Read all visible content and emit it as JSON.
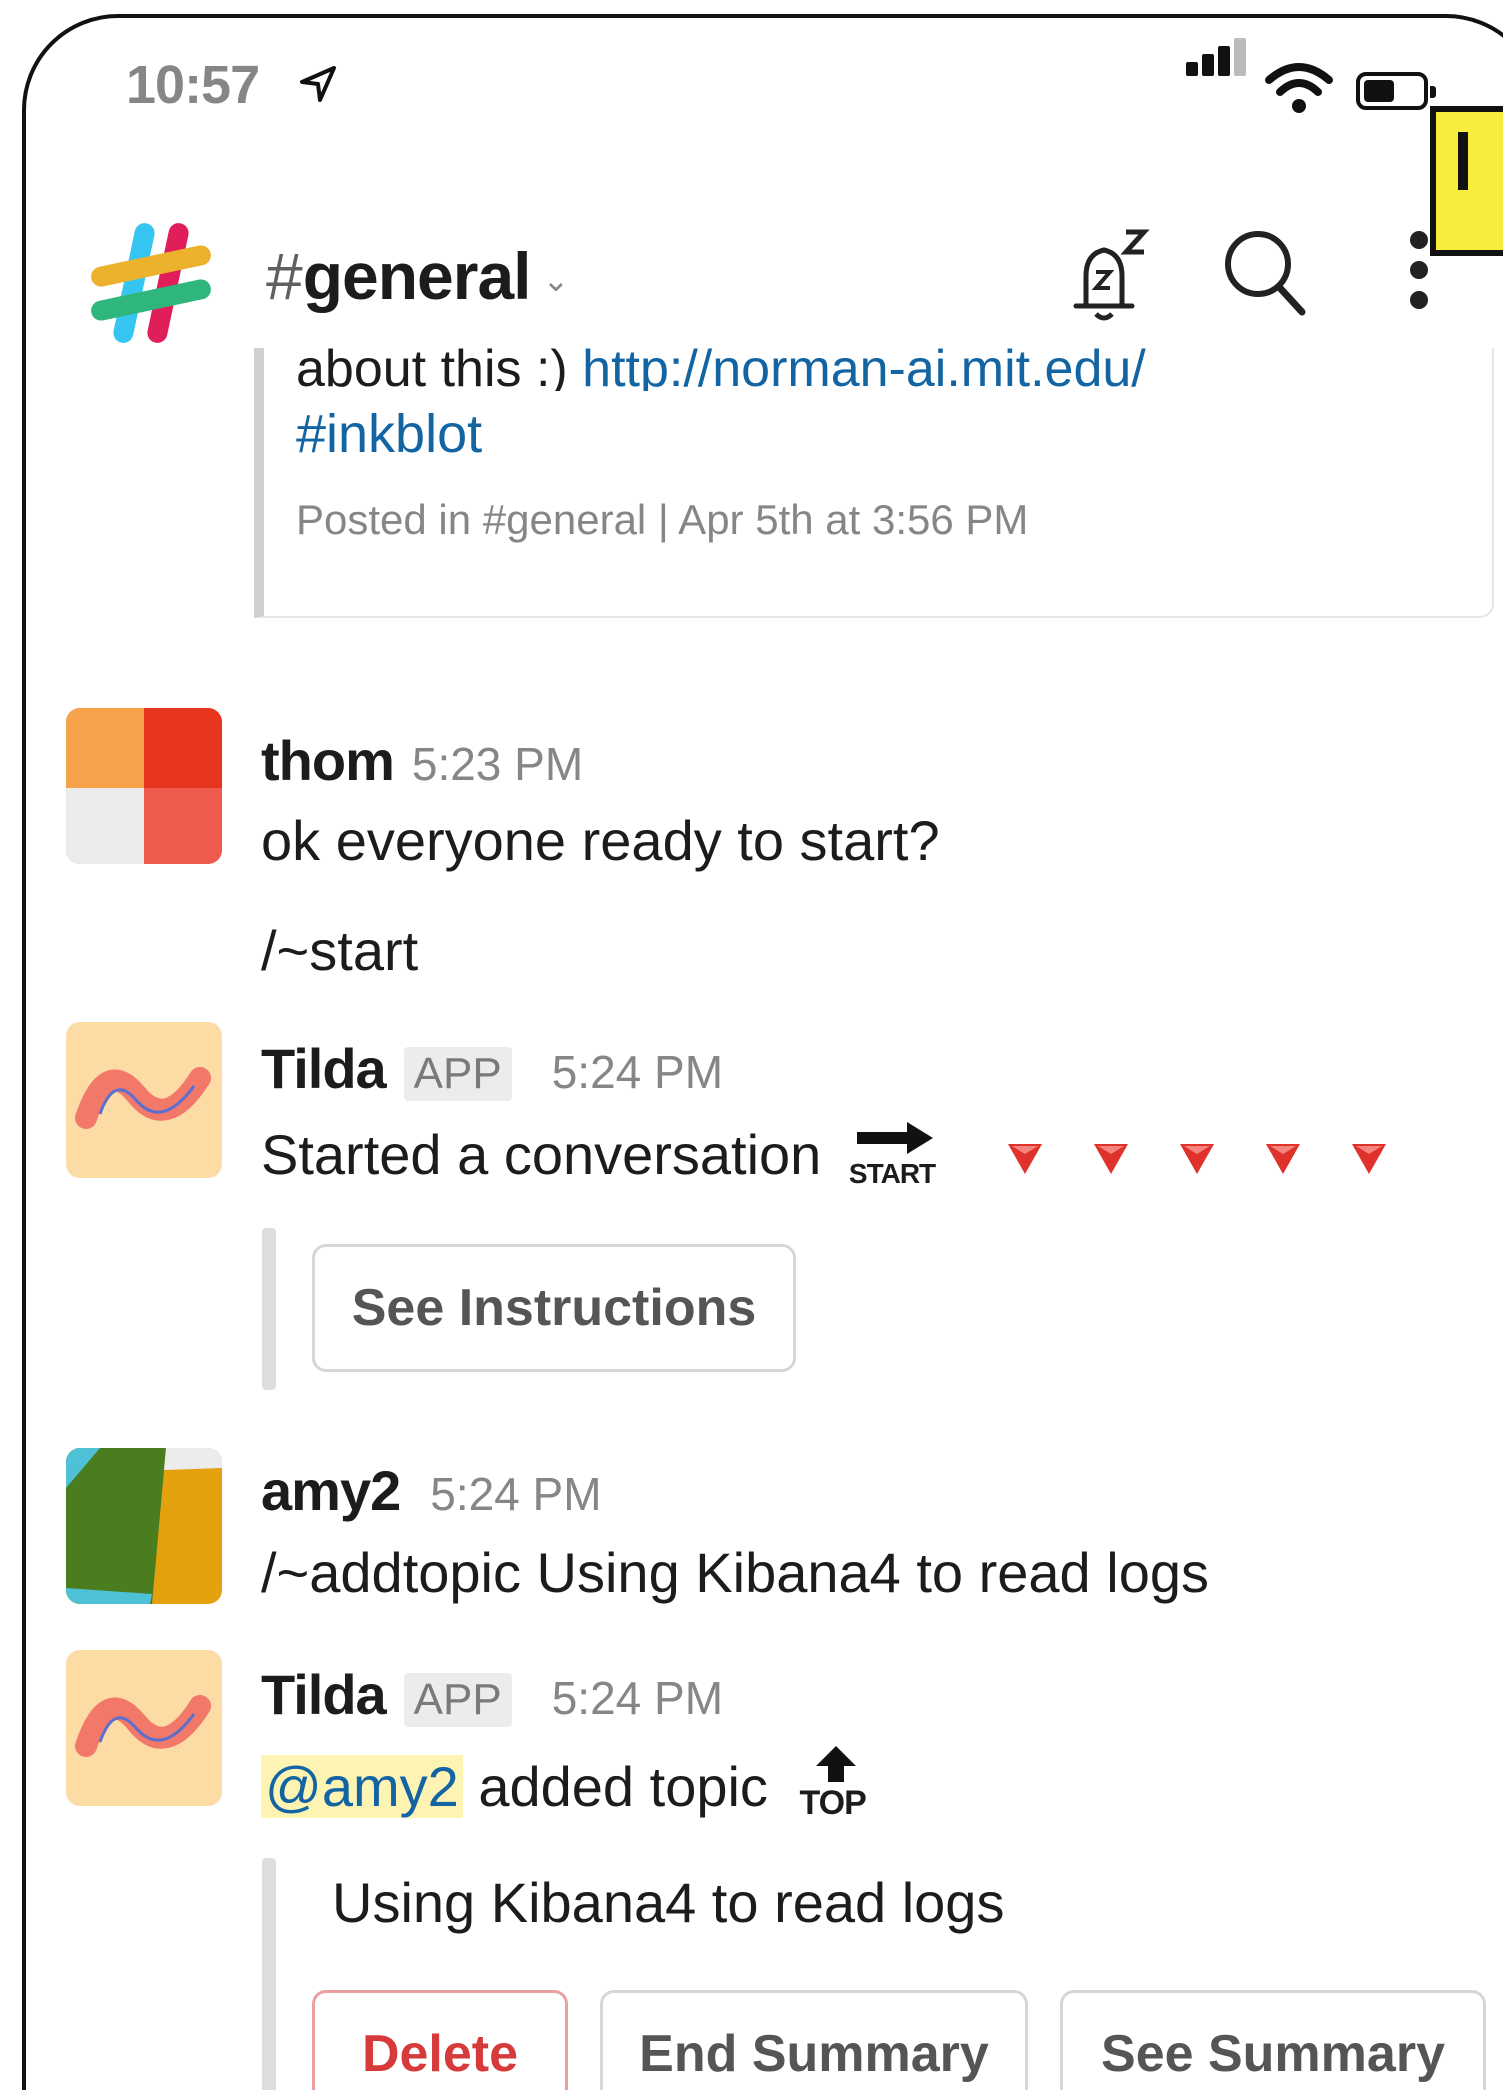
{
  "status_bar": {
    "time": "10:57"
  },
  "header": {
    "channel_hash": "#",
    "channel_name": "general"
  },
  "shared_post": {
    "text_partial": "about this :) ",
    "url": "http://norman-ai.mit.edu/",
    "tag": "#inkblot",
    "meta": "Posted in #general | Apr 5th at 3:56 PM"
  },
  "messages": [
    {
      "user": "thom",
      "time": "5:23 PM",
      "lines": [
        "ok everyone ready to start?",
        "/~start"
      ]
    },
    {
      "user": "Tilda",
      "badge": "APP",
      "time": "5:24 PM",
      "text": "Started a conversation",
      "emoji_label": "START",
      "button": "See Instructions"
    },
    {
      "user": "amy2",
      "time": "5:24 PM",
      "text": "/~addtopic Using Kibana4 to read logs"
    },
    {
      "user": "Tilda",
      "badge": "APP",
      "time": "5:24 PM",
      "mention": "@amy2",
      "text": " added topic",
      "emoji_label": "TOP",
      "topic": "Using Kibana4 to read logs",
      "buttons": {
        "delete": "Delete",
        "end": "End Summary",
        "see": "See Summary"
      }
    }
  ],
  "colors": {
    "link": "#1264a3",
    "danger": "#d63a3a",
    "highlight": "#fdf3b3",
    "alert_red": "#e0322d"
  }
}
